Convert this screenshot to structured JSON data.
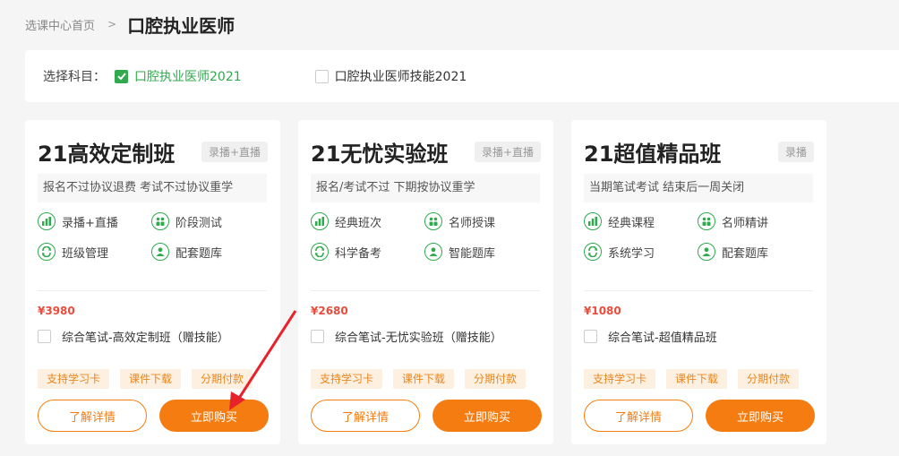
{
  "breadcrumb": {
    "home": "选课中心首页",
    "separator": ">",
    "current": "口腔执业医师"
  },
  "subject": {
    "label": "选择科目：",
    "options": [
      {
        "label": "口腔执业医师2021",
        "checked": true
      },
      {
        "label": "口腔执业医师技能2021",
        "checked": false
      }
    ]
  },
  "cards": [
    {
      "title": "21高效定制班",
      "tag": "录播+直播",
      "desc": "报名不过协议退费 考试不过协议重学",
      "features": [
        "录播+直播",
        "阶段测试",
        "班级管理",
        "配套题库"
      ],
      "price": "¥3980",
      "package": "综合笔试-高效定制班（赠技能）",
      "badges": [
        "支持学习卡",
        "课件下载",
        "分期付款"
      ],
      "detail_btn": "了解详情",
      "buy_btn": "立即购买"
    },
    {
      "title": "21无忧实验班",
      "tag": "录播+直播",
      "desc": "报名/考试不过 下期按协议重学",
      "features": [
        "经典班次",
        "名师授课",
        "科学备考",
        "智能题库"
      ],
      "price": "¥2680",
      "package": "综合笔试-无忧实验班（赠技能）",
      "badges": [
        "支持学习卡",
        "课件下载",
        "分期付款"
      ],
      "detail_btn": "了解详情",
      "buy_btn": "立即购买"
    },
    {
      "title": "21超值精品班",
      "tag": "录播",
      "desc": "当期笔试考试 结束后一周关闭",
      "features": [
        "经典课程",
        "名师精讲",
        "系统学习",
        "配套题库"
      ],
      "price": "¥1080",
      "package": "综合笔试-超值精品班",
      "badges": [
        "支持学习卡",
        "课件下载",
        "分期付款"
      ],
      "detail_btn": "了解详情",
      "buy_btn": "立即购买"
    }
  ],
  "colors": {
    "accent_green": "#30a94f",
    "accent_orange": "#f57c10",
    "price_red": "#e84c3d",
    "annotation_arrow": "#e8222a"
  },
  "feature_icons": [
    "chart-icon",
    "group-icon",
    "refresh-icon",
    "user-icon"
  ]
}
